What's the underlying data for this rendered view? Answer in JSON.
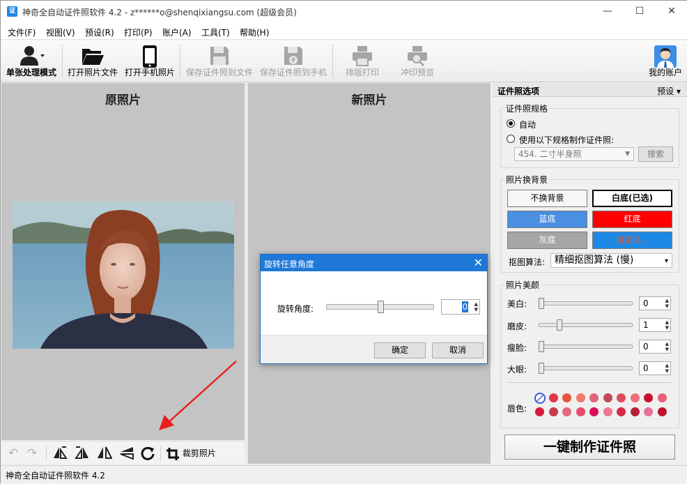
{
  "window": {
    "title": "神奇全自动证件照软件 4.2 - z******o@shenqixiangsu.com (超级会员)",
    "app_icon_text": "证",
    "controls": {
      "minimize": "—",
      "maximize": "☐",
      "close": "✕"
    }
  },
  "menu": [
    "文件(F)",
    "视图(V)",
    "预设(R)",
    "打印(P)",
    "账户(A)",
    "工具(T)",
    "帮助(H)"
  ],
  "toolbar": {
    "single_mode": "单张处理模式",
    "open_file": "打开照片文件",
    "open_phone": "打开手机照片",
    "save_file": "保存证件照到文件",
    "save_phone": "保存证件照到手机",
    "layout_print": "排版打印",
    "print_preview": "冲印预览",
    "my_account": "我的账户"
  },
  "panels": {
    "original_title": "原照片",
    "new_title": "新照片"
  },
  "bottom_tools": {
    "crop_label": "裁剪照片",
    "icons": [
      "undo-icon",
      "redo-icon",
      "flip-left-icon",
      "flip-right-icon",
      "mirror-horizontal-icon",
      "mirror-vertical-icon",
      "rotate-icon",
      "crop-icon"
    ]
  },
  "status": {
    "text": "神奇全自动证件照软件 4.2"
  },
  "right_panel": {
    "title": "证件照选项",
    "preset": "预设",
    "spec": {
      "label": "证件照规格",
      "auto": "自动",
      "use_spec": "使用以下规格制作证件照:",
      "combo_value": "454. 二寸半身照",
      "search": "搜索",
      "auto_selected": true
    },
    "background": {
      "label": "照片换背景",
      "no_change": "不换背景",
      "white": "白底(已选)",
      "blue": "蓝底",
      "red": "红底",
      "gray": "灰底",
      "custom": "自定义...",
      "algo_label": "抠图算法:",
      "algo_value": "精细抠图算法 (慢)",
      "colors": {
        "blue": "#4a8fe0",
        "red": "#ff0000",
        "gray": "#a6a6a6",
        "custom": "#1e88e5"
      }
    },
    "beauty": {
      "label": "照片美颜",
      "items": [
        {
          "label": "美白:",
          "value": "0",
          "level": 0
        },
        {
          "label": "磨皮:",
          "value": "1",
          "level": 0.2
        },
        {
          "label": "瘦脸:",
          "value": "0",
          "level": 0
        },
        {
          "label": "大眼:",
          "value": "0",
          "level": 0
        }
      ],
      "lip_label": "唇色:",
      "lip_colors_row1": [
        "none",
        "#e0344a",
        "#e8543c",
        "#f07a6a",
        "#e06478",
        "#c44a5a",
        "#e04a5e",
        "#f06e7a",
        "#c8102e",
        "#e8607a"
      ],
      "lip_colors_row2": [
        "#d81b3c",
        "#c83c4a",
        "#e06a7a",
        "#e84a6a",
        "#d8105a",
        "#f07890",
        "#d82848",
        "#b8203a",
        "#e8709a",
        "#c0142c"
      ]
    },
    "make_button": "一键制作证件照"
  },
  "dialog": {
    "title": "旋转任意角度",
    "close": "✕",
    "angle_label": "旋转角度:",
    "angle_value": "0",
    "slider_level": 0.5,
    "ok": "确定",
    "cancel": "取消"
  }
}
